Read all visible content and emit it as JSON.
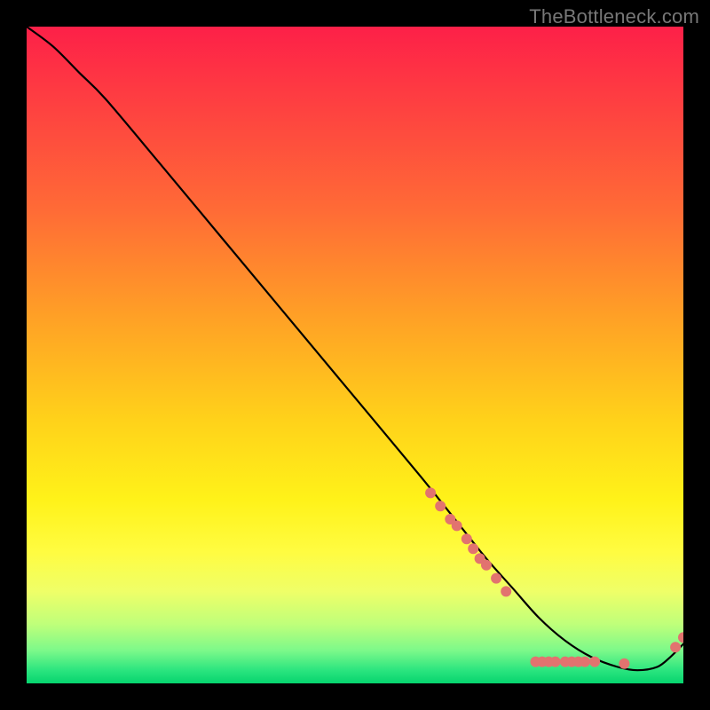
{
  "watermark": "TheBottleneck.com",
  "chart_data": {
    "type": "line",
    "title": "",
    "xlabel": "",
    "ylabel": "",
    "xlim": [
      0,
      100
    ],
    "ylim": [
      0,
      100
    ],
    "grid": false,
    "legend": false,
    "series": [
      {
        "name": "curve",
        "x": [
          0,
          4,
          8,
          12,
          20,
          30,
          40,
          50,
          60,
          66,
          70,
          74,
          78,
          82,
          86,
          90,
          93,
          96,
          98,
          100
        ],
        "y": [
          100,
          97,
          93,
          89,
          79.5,
          67.5,
          55.5,
          43.5,
          31.5,
          24,
          19,
          14.5,
          10,
          6.5,
          4,
          2.5,
          2,
          2.5,
          4,
          6
        ]
      }
    ],
    "markers": [
      {
        "x": 61.5,
        "y": 29.0
      },
      {
        "x": 63.0,
        "y": 27.0
      },
      {
        "x": 64.5,
        "y": 25.0
      },
      {
        "x": 65.5,
        "y": 24.0
      },
      {
        "x": 67.0,
        "y": 22.0
      },
      {
        "x": 68.0,
        "y": 20.5
      },
      {
        "x": 69.0,
        "y": 19.0
      },
      {
        "x": 70.0,
        "y": 18.0
      },
      {
        "x": 71.5,
        "y": 16.0
      },
      {
        "x": 73.0,
        "y": 14.0
      },
      {
        "x": 77.5,
        "y": 3.3
      },
      {
        "x": 78.5,
        "y": 3.3
      },
      {
        "x": 79.5,
        "y": 3.3
      },
      {
        "x": 80.5,
        "y": 3.3
      },
      {
        "x": 82.0,
        "y": 3.3
      },
      {
        "x": 83.0,
        "y": 3.3
      },
      {
        "x": 84.0,
        "y": 3.3
      },
      {
        "x": 85.0,
        "y": 3.3
      },
      {
        "x": 86.5,
        "y": 3.3
      },
      {
        "x": 91.0,
        "y": 3.0
      },
      {
        "x": 98.8,
        "y": 5.5
      },
      {
        "x": 100.0,
        "y": 7.0
      }
    ],
    "marker_color": "#e2736f",
    "curve_color": "#000000"
  }
}
